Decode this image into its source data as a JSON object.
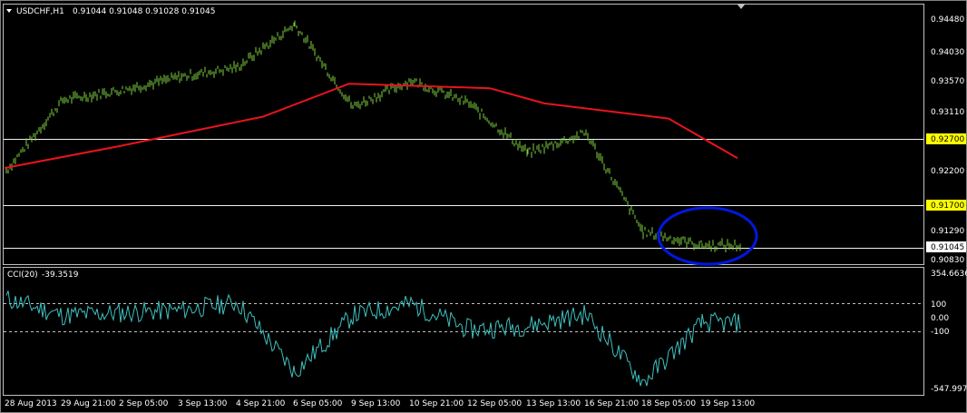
{
  "header": {
    "symbol": "USDCHF,H1",
    "ohlc": "0.91044 0.91048 0.91028 0.91045"
  },
  "cci_header": {
    "name": "CCI(20)",
    "value": "-39.3519"
  },
  "colors": {
    "background": "#000000",
    "price_bars": "#7fcf3f",
    "moving_average": "#e8141e",
    "cci_line": "#3fbfbf",
    "horizontal_lines": "#f0f0f0",
    "hline_label_bg": "#ffff00",
    "annotation_circle": "#0018e0"
  },
  "price_axis": {
    "labels": [
      "0.94480",
      "0.94030",
      "0.93570",
      "0.93110",
      "0.92700",
      "0.92200",
      "0.91700",
      "0.91290",
      "0.91045",
      "0.90830"
    ]
  },
  "cci_axis": {
    "labels": [
      "354.6636",
      "100",
      "0.00",
      "-100",
      "-547.9974"
    ]
  },
  "time_axis": {
    "labels": [
      "28 Aug 2013",
      "29 Aug 21:00",
      "2 Sep 05:00",
      "3 Sep 13:00",
      "4 Sep 21:00",
      "6 Sep 05:00",
      "9 Sep 13:00",
      "10 Sep 21:00",
      "12 Sep 05:00",
      "13 Sep 13:00",
      "16 Sep 21:00",
      "18 Sep 05:00",
      "19 Sep 13:00"
    ]
  },
  "chart_data": {
    "type": "line",
    "symbol": "USDCHF",
    "timeframe": "H1",
    "price_series": {
      "name": "USDCHF,H1",
      "x": [
        "28 Aug 2013",
        "29 Aug 21:00",
        "2 Sep 05:00",
        "3 Sep 13:00",
        "4 Sep 21:00",
        "6 Sep 05:00",
        "9 Sep 13:00",
        "10 Sep 21:00",
        "12 Sep 05:00",
        "13 Sep 13:00",
        "16 Sep 21:00",
        "18 Sep 05:00",
        "19 Sep 13:00"
      ],
      "close": [
        0.9218,
        0.9325,
        0.934,
        0.936,
        0.9375,
        0.944,
        0.9315,
        0.9355,
        0.932,
        0.9245,
        0.9275,
        0.9125,
        0.91045
      ]
    },
    "moving_average": {
      "x": [
        "28 Aug 2013",
        "2 Sep 05:00",
        "4 Sep 21:00",
        "6 Sep 05:00",
        "10 Sep 21:00",
        "13 Sep 13:00",
        "18 Sep 05:00",
        "19 Sep 13:00"
      ],
      "values": [
        0.9222,
        0.9255,
        0.93,
        0.935,
        0.9343,
        0.932,
        0.9297,
        0.9237
      ]
    },
    "horizontal_levels": [
      0.927,
      0.917,
      0.91045
    ],
    "price_ylim": [
      0.9083,
      0.9448
    ],
    "cci": {
      "name": "CCI(20)",
      "x": [
        "28 Aug 2013",
        "29 Aug 21:00",
        "2 Sep 05:00",
        "3 Sep 13:00",
        "4 Sep 21:00",
        "6 Sep 05:00",
        "9 Sep 13:00",
        "10 Sep 21:00",
        "12 Sep 05:00",
        "13 Sep 13:00",
        "16 Sep 21:00",
        "18 Sep 05:00",
        "19 Sep 13:00"
      ],
      "values": [
        150,
        20,
        40,
        60,
        120,
        -420,
        20,
        110,
        -90,
        -60,
        30,
        -500,
        -39.3519
      ],
      "levels": [
        100,
        0,
        -100
      ],
      "ylim": [
        -547.9974,
        354.6636
      ]
    },
    "annotation": "ellipse"
  }
}
